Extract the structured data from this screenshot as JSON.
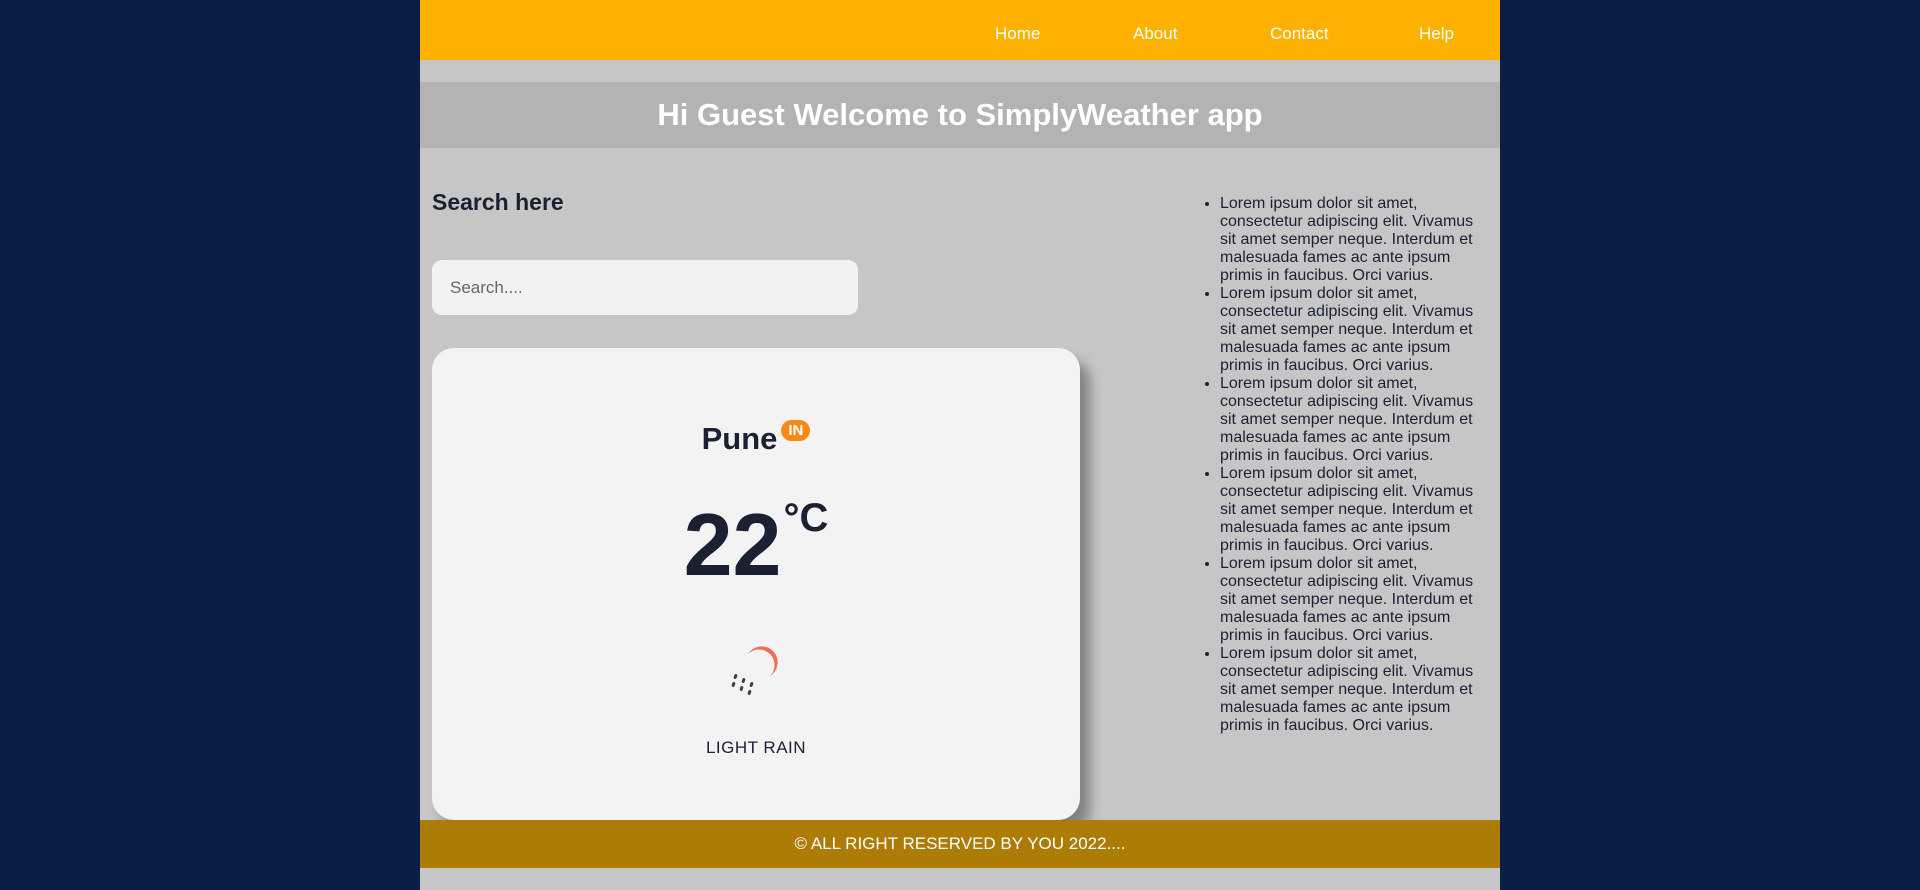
{
  "nav": {
    "items": [
      {
        "label": "Home"
      },
      {
        "label": "About"
      },
      {
        "label": "Contact"
      },
      {
        "label": "Help"
      }
    ]
  },
  "banner": {
    "title": "Hi Guest Welcome to SimplyWeather app"
  },
  "search": {
    "heading": "Search here",
    "placeholder": "Search...."
  },
  "weather": {
    "city": "Pune",
    "country": "IN",
    "temperature": "22",
    "unit": "°C",
    "condition": "LIGHT RAIN",
    "icon": "light-rain-icon",
    "icon_color": "#f26c4f"
  },
  "info_list": {
    "items": [
      "Lorem ipsum dolor sit amet, consectetur adipiscing elit. Vivamus sit amet semper neque. Interdum et malesuada fames ac ante ipsum primis in faucibus. Orci varius.",
      "Lorem ipsum dolor sit amet, consectetur adipiscing elit. Vivamus sit amet semper neque. Interdum et malesuada fames ac ante ipsum primis in faucibus. Orci varius.",
      "Lorem ipsum dolor sit amet, consectetur adipiscing elit. Vivamus sit amet semper neque. Interdum et malesuada fames ac ante ipsum primis in faucibus. Orci varius.",
      "Lorem ipsum dolor sit amet, consectetur adipiscing elit. Vivamus sit amet semper neque. Interdum et malesuada fames ac ante ipsum primis in faucibus. Orci varius.",
      "Lorem ipsum dolor sit amet, consectetur adipiscing elit. Vivamus sit amet semper neque. Interdum et malesuada fames ac ante ipsum primis in faucibus. Orci varius.",
      "Lorem ipsum dolor sit amet, consectetur adipiscing elit. Vivamus sit amet semper neque. Interdum et malesuada fames ac ante ipsum primis in faucibus. Orci varius."
    ]
  },
  "footer": {
    "text": "© ALL RIGHT RESERVED BY YOU 2022...."
  },
  "colors": {
    "page_background": "#0b1e47",
    "nav_background": "#ffb100",
    "banner_background": "#b3b3b3",
    "content_background": "#c6c6c6",
    "footer_background": "#ad7c06",
    "badge": "#f68a15"
  }
}
